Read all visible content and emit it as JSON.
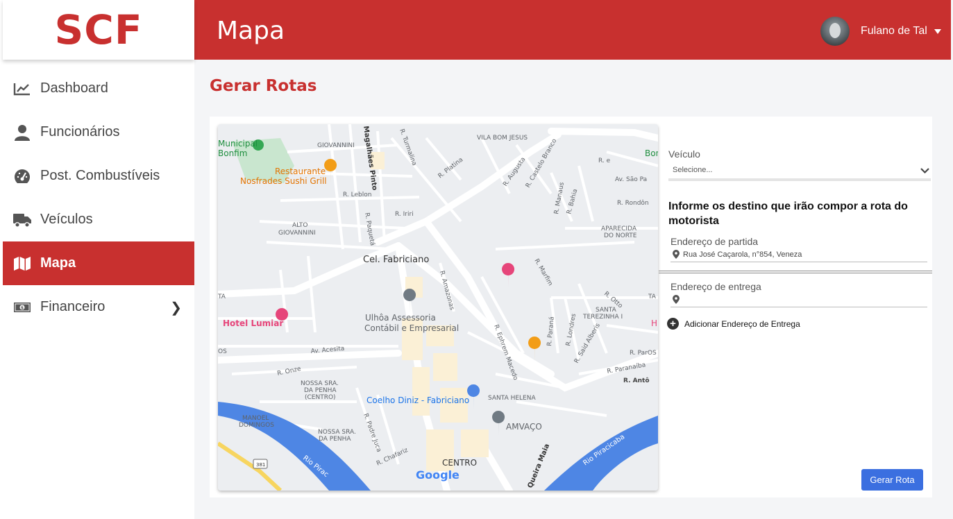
{
  "app": {
    "logo_text": "SCF"
  },
  "header": {
    "title": "Mapa",
    "user_name": "Fulano de Tal"
  },
  "sidebar": {
    "items": [
      {
        "label": "Dashboard",
        "icon": "chart-line-icon"
      },
      {
        "label": "Funcionários",
        "icon": "user-icon"
      },
      {
        "label": "Post. Combustíveis",
        "icon": "gauge-icon"
      },
      {
        "label": "Veículos",
        "icon": "truck-icon"
      },
      {
        "label": "Mapa",
        "icon": "map-icon",
        "active": true
      },
      {
        "label": "Financeiro",
        "icon": "money-icon",
        "has_submenu": true
      }
    ]
  },
  "page": {
    "title": "Gerar Rotas"
  },
  "map": {
    "labels": {
      "municipal": "Municipal",
      "bonfim": "Bonfim",
      "giovannini": "GIOVANNINI",
      "magalhaes": "Magalhães Pinto",
      "turmalina": "R. Turmalina",
      "vila_bom_jesus": "VILA BOM JESUS",
      "restaurante1": "Restaurante",
      "restaurante2": "Nosfrades Sushi Grill",
      "platina": "R. Platina",
      "augusta": "R. Augusta",
      "castelo_branco": "R. Castelo Branco",
      "leblon": "R. Leblon",
      "iriri": "R. Iriri",
      "paqueta": "R. Paquetá",
      "alto_giovannini_1": "ALTO",
      "alto_giovannini_2": "GIOVANNINI",
      "manaus": "R. Manaus",
      "bahia": "R. Bahia",
      "sao_pa": "Av. São Pa",
      "rondon": "R. Rondôn",
      "aparecida_1": "APARECIDA",
      "aparecida_2": "DO NORTE",
      "cel_fabriciano": "Cel. Fabriciano",
      "marfim": "R. Marfim",
      "amazonas": "R. Amazonas",
      "ulhoa_1": "Ulhôa Assessoria",
      "ulhoa_2": "Contábil e Empresarial",
      "hotel": "Hotel Lumiar",
      "santa_terezinha_1": "SANTA",
      "santa_terezinha_2": "TEREZINHA I",
      "acesita": "Av. Acesita",
      "efrem": "R. Ephrem Macedo",
      "parana": "R. Paraná",
      "londres": "R. Londres",
      "said": "R. Said Alberis",
      "otto": "R. Otto",
      "onze": "R. Onze",
      "nossa_sra_1_a": "NOSSA SRA.",
      "nossa_sra_1_b": "DA PENHA",
      "nossa_sra_1_c": "(CENTRO)",
      "paranaiba": "R. Paranaíba",
      "r_anto": "R. Antô",
      "coelho_diniz": "Coelho Diniz - Fabriciano",
      "santa_helena": "SANTA HELENA",
      "manoel_1": "MANOEL",
      "manoel_2": "DOMINGOS",
      "nossa_sra_2_a": "NOSSA SRA.",
      "nossa_sra_2_b": "DA PENHA",
      "padre_juca": "R. Padre Juca",
      "amvaco": "AMVAÇO",
      "rio_piracicaba_right": "Rio Piracicaba",
      "chafariz": "R. Chafariz",
      "centro": "CENTRO",
      "rio_pira_left": "Rio Pirac",
      "road_381": "381",
      "queira_maia": "Queira Maia",
      "google": "Google",
      "ta_left": "TA",
      "os_left": "OS",
      "ta_right": "TA",
      "h_right": "H",
      "paros_right": "R. ParOS",
      "r_e": "R. e",
      "bonfim_right": "Bonfim"
    }
  },
  "form": {
    "vehicle_label": "Veículo",
    "vehicle_value": "Selecione...",
    "heading": "Informe os destino que irão compor a rota do motorista",
    "start_label": "Endereço de partida",
    "start_value": "Rua José Caçarola, n°854, Veneza",
    "delivery_label": "Endereço de entrega",
    "delivery_value": "",
    "add_label": "Adicionar Endereço de Entrega",
    "submit_label": "Gerar Rota"
  },
  "colors": {
    "brand_red": "#c8302f",
    "primary_blue": "#3b6fe0",
    "map_bg": "#eceef1",
    "river": "#4e86e4"
  }
}
